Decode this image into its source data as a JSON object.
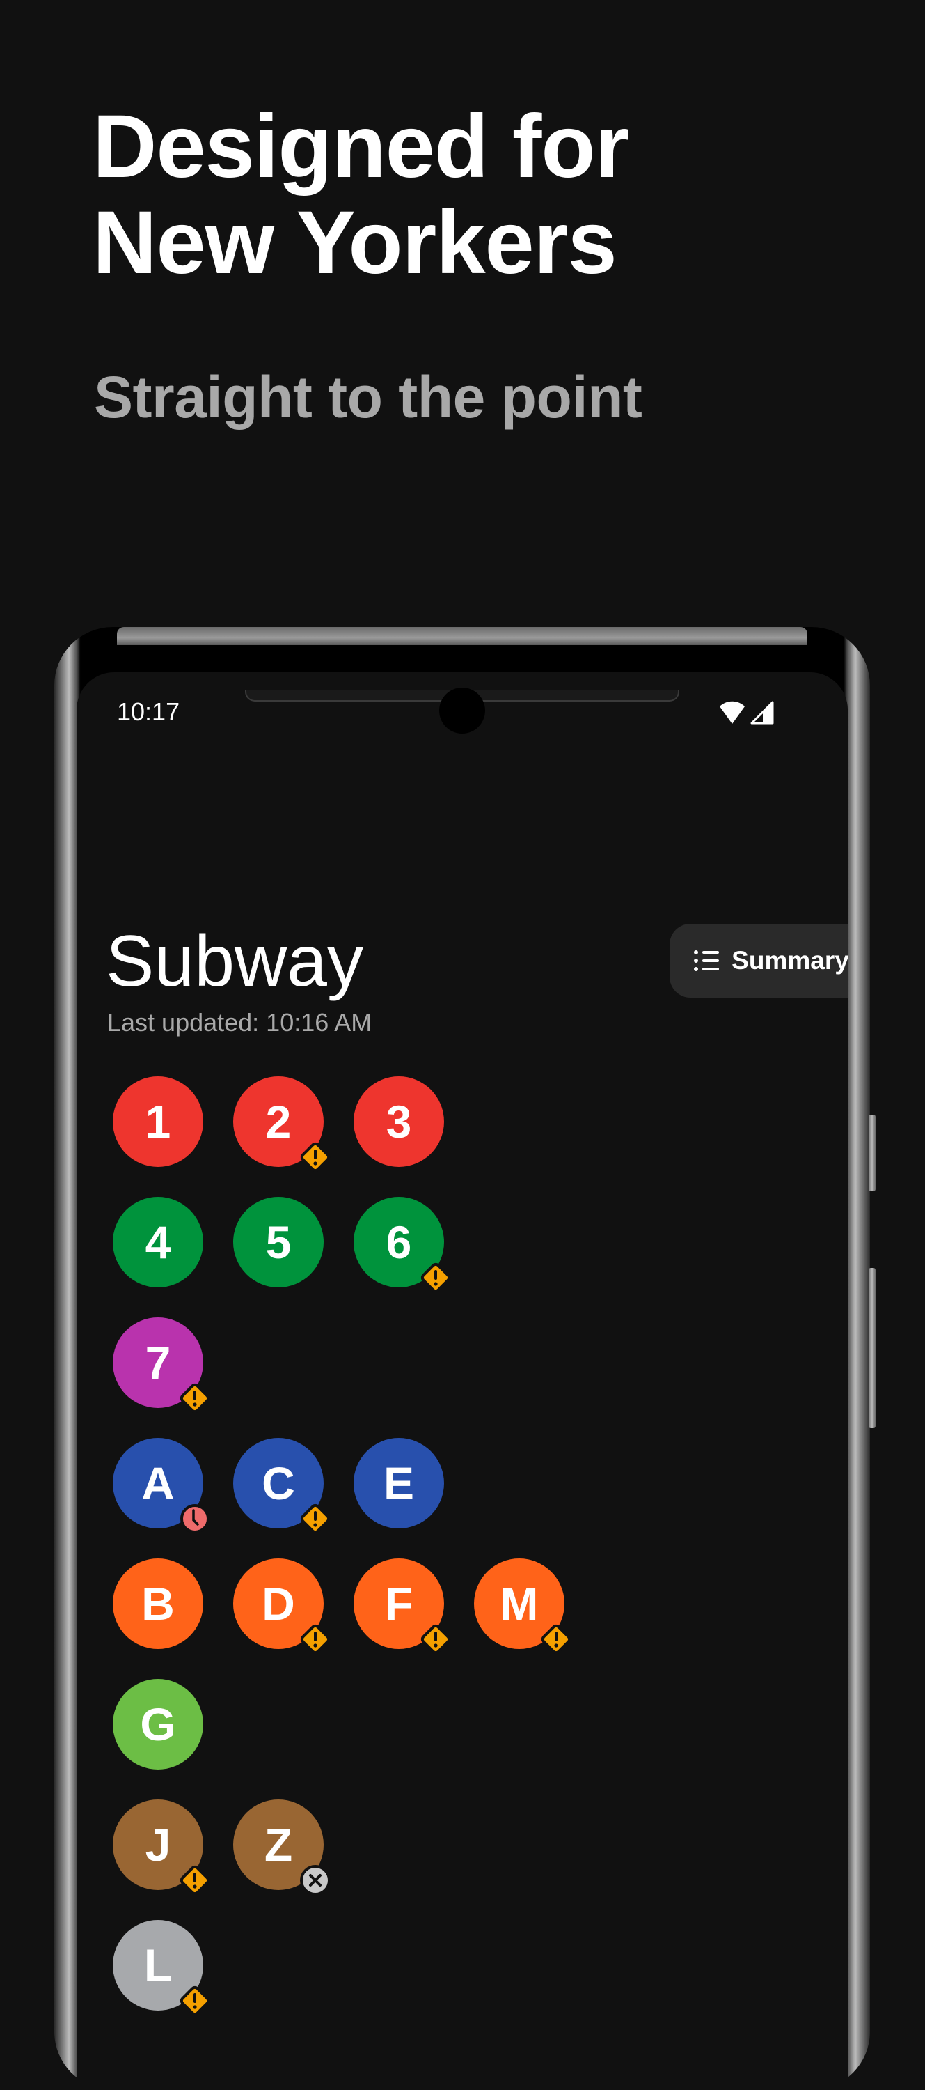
{
  "hero": {
    "headline_line1": "Designed for",
    "headline_line2": "New Yorkers",
    "subheadline": "Straight to the point"
  },
  "status_bar": {
    "time": "10:17",
    "icons": [
      "wifi-icon",
      "cellular-signal-icon"
    ]
  },
  "app": {
    "title": "Subway",
    "last_updated": "Last updated: 10:16 AM",
    "summary_button": {
      "label": "Summary",
      "icon": "list-icon"
    }
  },
  "status_colors": {
    "delays": "#f5a000",
    "slow": "#ef6b6b",
    "suspended": "#c8c8c8"
  },
  "line_groups": [
    {
      "lines": [
        {
          "id": "1",
          "color": "#ee352e",
          "status": null
        },
        {
          "id": "2",
          "color": "#ee352e",
          "status": "delays"
        },
        {
          "id": "3",
          "color": "#ee352e",
          "status": null
        }
      ]
    },
    {
      "lines": [
        {
          "id": "4",
          "color": "#00933c",
          "status": null
        },
        {
          "id": "5",
          "color": "#00933c",
          "status": null
        },
        {
          "id": "6",
          "color": "#00933c",
          "status": "delays"
        }
      ]
    },
    {
      "lines": [
        {
          "id": "7",
          "color": "#b933ad",
          "status": "delays"
        }
      ]
    },
    {
      "lines": [
        {
          "id": "A",
          "color": "#2850ad",
          "status": "slow"
        },
        {
          "id": "C",
          "color": "#2850ad",
          "status": "delays"
        },
        {
          "id": "E",
          "color": "#2850ad",
          "status": null
        }
      ]
    },
    {
      "lines": [
        {
          "id": "B",
          "color": "#ff6319",
          "status": null
        },
        {
          "id": "D",
          "color": "#ff6319",
          "status": "delays"
        },
        {
          "id": "F",
          "color": "#ff6319",
          "status": "delays"
        },
        {
          "id": "M",
          "color": "#ff6319",
          "status": "delays"
        }
      ]
    },
    {
      "lines": [
        {
          "id": "G",
          "color": "#6cbe45",
          "status": null
        }
      ]
    },
    {
      "lines": [
        {
          "id": "J",
          "color": "#996633",
          "status": "delays"
        },
        {
          "id": "Z",
          "color": "#996633",
          "status": "suspended"
        }
      ]
    },
    {
      "lines": [
        {
          "id": "L",
          "color": "#a7a9ac",
          "status": "delays"
        }
      ]
    }
  ]
}
